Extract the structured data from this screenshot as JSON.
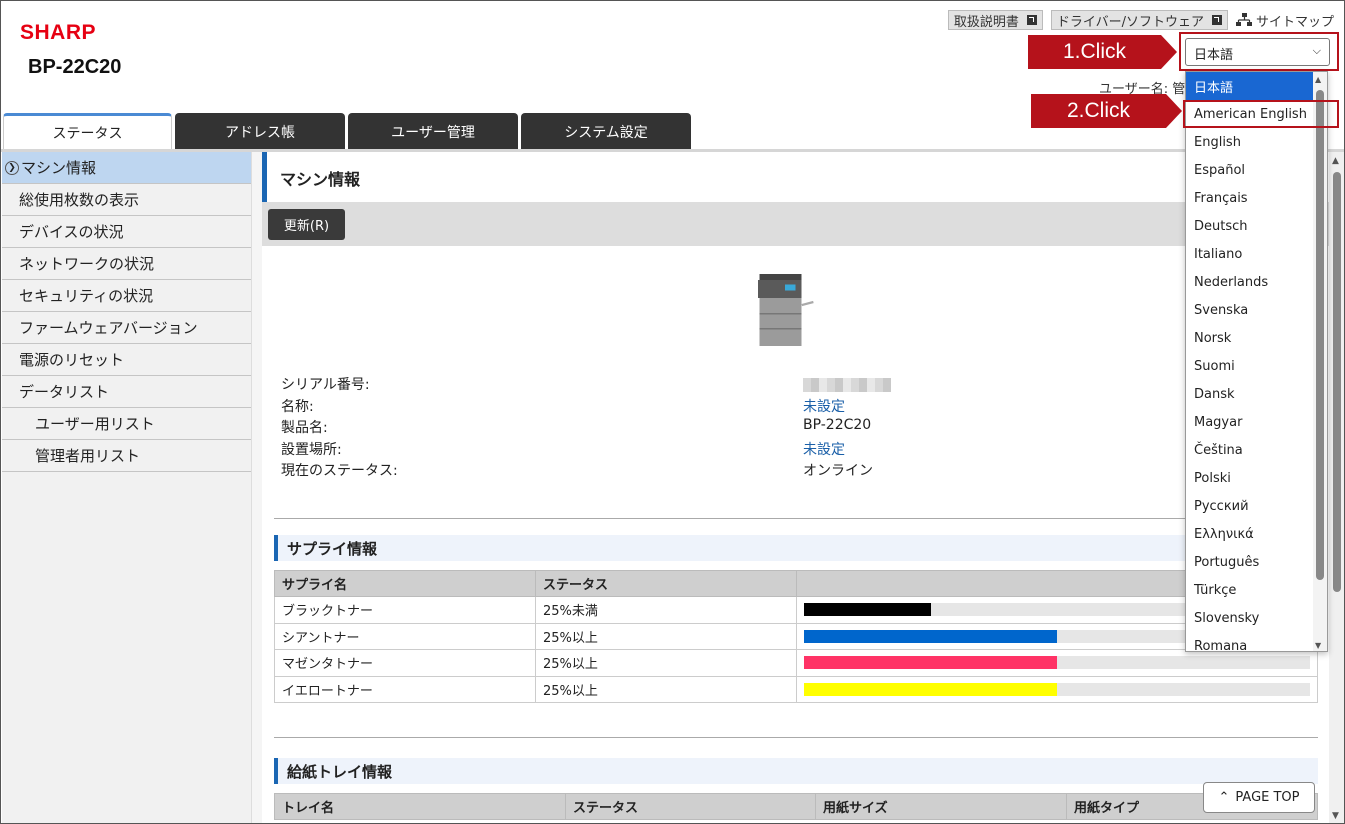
{
  "header": {
    "brand": "SHARP",
    "model": "BP-22C20",
    "links": [
      {
        "label": "取扱説明書"
      },
      {
        "label": "ドライバー/ソフトウェア"
      }
    ],
    "sitemap": "サイトマップ",
    "user_label": "ユーザー名: 管",
    "language_selected": "日本語"
  },
  "callouts": {
    "step1": "1.Click",
    "step2": "2.Click"
  },
  "tabs": [
    {
      "label": "ステータス",
      "active": true
    },
    {
      "label": "アドレス帳"
    },
    {
      "label": "ユーザー管理"
    },
    {
      "label": "システム設定"
    }
  ],
  "sidebar": {
    "items": [
      {
        "label": "マシン情報",
        "active": true
      },
      {
        "label": "総使用枚数の表示"
      },
      {
        "label": "デバイスの状況"
      },
      {
        "label": "ネットワークの状況"
      },
      {
        "label": "セキュリティの状況"
      },
      {
        "label": "ファームウェアバージョン"
      },
      {
        "label": "電源のリセット"
      },
      {
        "label": "データリスト"
      },
      {
        "label": "ユーザー用リスト",
        "sub": true
      },
      {
        "label": "管理者用リスト",
        "sub": true
      }
    ]
  },
  "main": {
    "title": "マシン情報",
    "refresh_button": "更新(R)",
    "info": [
      {
        "label": "シリアル番号:",
        "value": ""
      },
      {
        "label": "名称:",
        "value": "未設定"
      },
      {
        "label": "製品名:",
        "value": "BP-22C20"
      },
      {
        "label": "設置場所:",
        "value": "未設定"
      },
      {
        "label": "現在のステータス:",
        "value": "オンライン"
      }
    ],
    "supply": {
      "title": "サプライ情報",
      "columns": [
        "サプライ名",
        "ステータス"
      ],
      "rows": [
        {
          "name": "ブラックトナー",
          "status": "25%未満",
          "level": 25,
          "color": "#000000"
        },
        {
          "name": "シアントナー",
          "status": "25%以上",
          "level": 50,
          "color": "#0066cc"
        },
        {
          "name": "マゼンタトナー",
          "status": "25%以上",
          "level": 50,
          "color": "#ff3366"
        },
        {
          "name": "イエロートナー",
          "status": "25%以上",
          "level": 50,
          "color": "#ffff00"
        }
      ]
    },
    "tray": {
      "title": "給紙トレイ情報",
      "columns": [
        "トレイ名",
        "ステータス",
        "用紙サイズ",
        "用紙タイプ"
      ]
    },
    "page_top": "PAGE TOP"
  },
  "language_dropdown": {
    "options": [
      "日本語",
      "American English",
      "English",
      "Español",
      "Français",
      "Deutsch",
      "Italiano",
      "Nederlands",
      "Svenska",
      "Norsk",
      "Suomi",
      "Dansk",
      "Magyar",
      "Čeština",
      "Polski",
      "Русский",
      "Ελληνικά",
      "Português",
      "Türkçe",
      "Slovensky",
      "Romana"
    ],
    "highlighted_index": 0
  },
  "colors": {
    "brand_red": "#e60012",
    "callout_red": "#b5121b",
    "accent_blue": "#1a66b3"
  }
}
